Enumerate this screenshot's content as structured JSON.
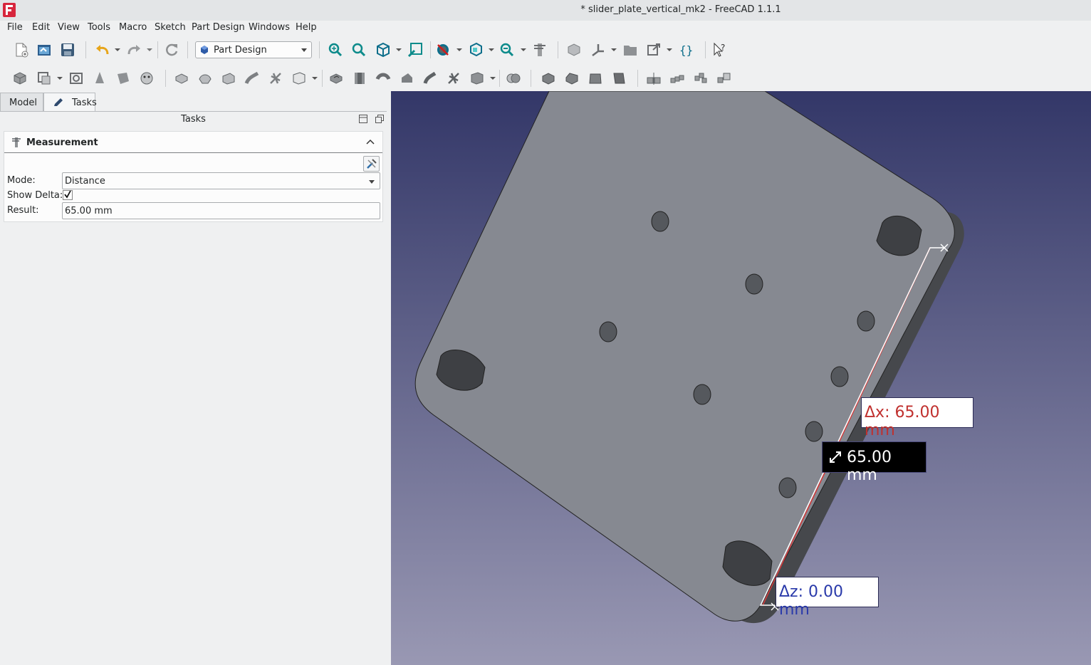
{
  "window": {
    "title": "* slider_plate_vertical_mk2 - FreeCAD 1.1.1"
  },
  "menu": [
    "File",
    "Edit",
    "View",
    "Tools",
    "Macro",
    "Sketch",
    "Part Design",
    "Windows",
    "Help"
  ],
  "toolbar": {
    "workbench": "Part Design"
  },
  "tabs": {
    "model": "Model",
    "tasks": "Tasks"
  },
  "tasks_panel": {
    "header": "Tasks",
    "measurement": {
      "title": "Measurement",
      "mode_label": "Mode:",
      "mode_value": "Distance",
      "show_delta_label": "Show Delta:",
      "show_delta_checked": true,
      "result_label": "Result:",
      "result_value": "65.00 mm"
    }
  },
  "viewport": {
    "delta_x_label": "Δx: 65.00 mm",
    "delta_z_label": "Δz: 0.00 mm",
    "distance_label": "65.00 mm"
  },
  "colors": {
    "viewport_top": "#333768",
    "viewport_bottom": "#9998b3",
    "plate": "#868991",
    "delta_x": "#c0302e",
    "delta_z": "#2a3aaa"
  }
}
